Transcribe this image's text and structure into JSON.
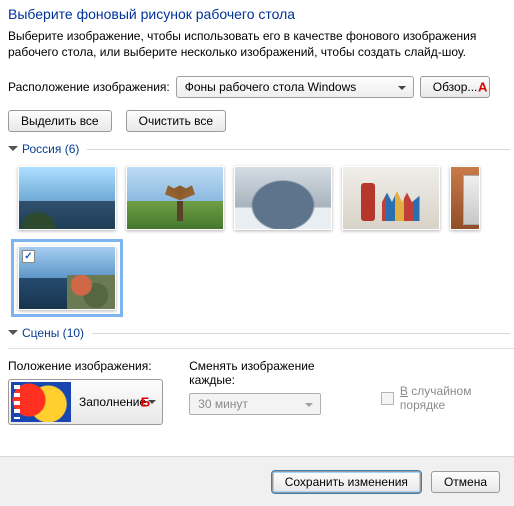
{
  "title": "Выберите фоновый рисунок рабочего стола",
  "description": "Выберите изображение, чтобы использовать его в качестве фонового изображения рабочего стола, или выберите несколько изображений, чтобы создать слайд-шоу.",
  "location": {
    "label": "Расположение изображения:",
    "value": "Фоны рабочего стола Windows",
    "browse": "Обзор..."
  },
  "selection": {
    "select_all": "Выделить все",
    "clear_all": "Очистить все"
  },
  "groups": {
    "russia": {
      "label": "Россия",
      "count": 6
    },
    "scenes": {
      "label": "Сцены",
      "count": 10
    }
  },
  "position": {
    "label": "Положение изображения:",
    "value": "Заполнение"
  },
  "interval": {
    "label": "Сменять изображение каждые:",
    "value": "30 минут"
  },
  "shuffle": {
    "label_pre": "В",
    "label_post": " случайном порядке"
  },
  "footer": {
    "save": "Сохранить изменения",
    "cancel": "Отмена"
  },
  "markers": {
    "a": "А",
    "b": "Б"
  }
}
